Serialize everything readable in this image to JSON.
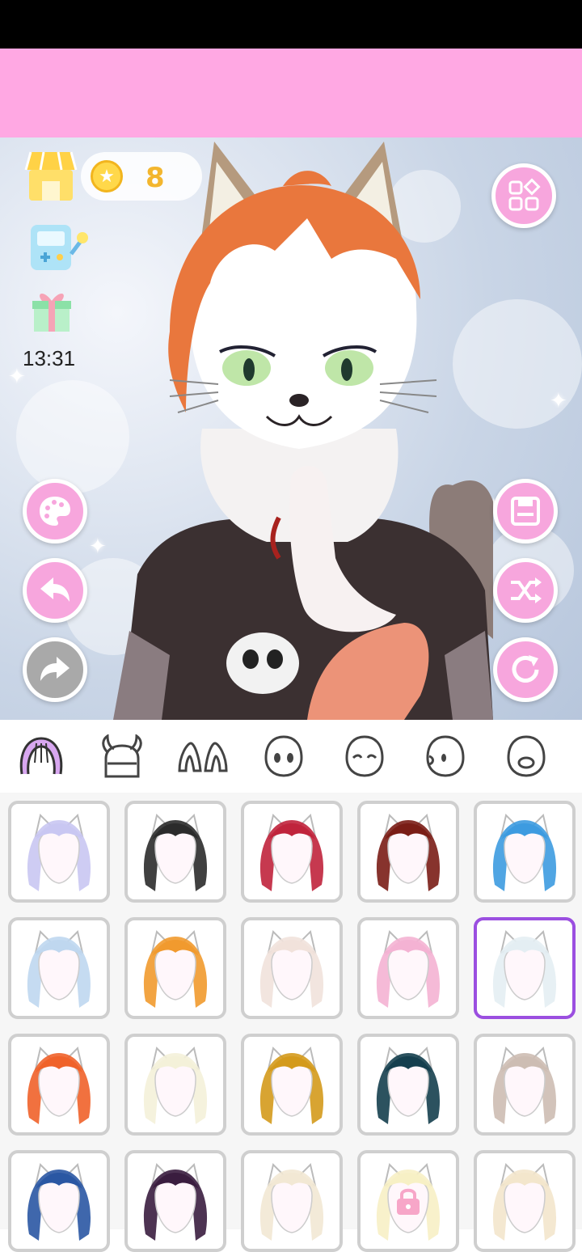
{
  "status_bar": {},
  "header": {},
  "hud": {
    "coins": "8",
    "time": "13:31",
    "shop_icon": "shop-icon",
    "game_icon": "game-console-icon",
    "gift_icon": "gift-icon",
    "coin_icon": "star-coin-icon"
  },
  "side_buttons": {
    "left": [
      "palette-icon",
      "undo-icon",
      "redo-icon"
    ],
    "right": [
      "menu-grid-icon",
      "save-icon",
      "shuffle-icon",
      "reset-icon"
    ]
  },
  "category_tabs": [
    {
      "icon": "hair-icon",
      "active": true
    },
    {
      "icon": "horns-icon",
      "active": false
    },
    {
      "icon": "ears-icon",
      "active": false
    },
    {
      "icon": "face-icon",
      "active": false
    },
    {
      "icon": "smile-face-icon",
      "active": false
    },
    {
      "icon": "side-face-icon",
      "active": false
    },
    {
      "icon": "mouth-face-icon",
      "active": false
    }
  ],
  "hair_items": [
    {
      "color": "#c9c7f2"
    },
    {
      "color": "#2b2b2b"
    },
    {
      "color": "#c0243c"
    },
    {
      "color": "#7a1d16"
    },
    {
      "color": "#3d9be0"
    },
    {
      "color": "#bfd7ef"
    },
    {
      "color": "#f19a2e"
    },
    {
      "color": "#f1e2db"
    },
    {
      "color": "#f4b2d3"
    },
    {
      "color": "#e4eef3"
    },
    {
      "color": "#f0622a"
    },
    {
      "color": "#f4f1d9"
    },
    {
      "color": "#d49a1c"
    },
    {
      "color": "#153f4e"
    },
    {
      "color": "#cdbdb3"
    },
    {
      "color": "#2a57a3"
    },
    {
      "color": "#3a1d3f"
    },
    {
      "color": "#f2e8d4"
    },
    {
      "color": "#f7f0c5",
      "locked": true
    },
    {
      "color": "#f3e6cc"
    }
  ],
  "selected_item_index": 9
}
